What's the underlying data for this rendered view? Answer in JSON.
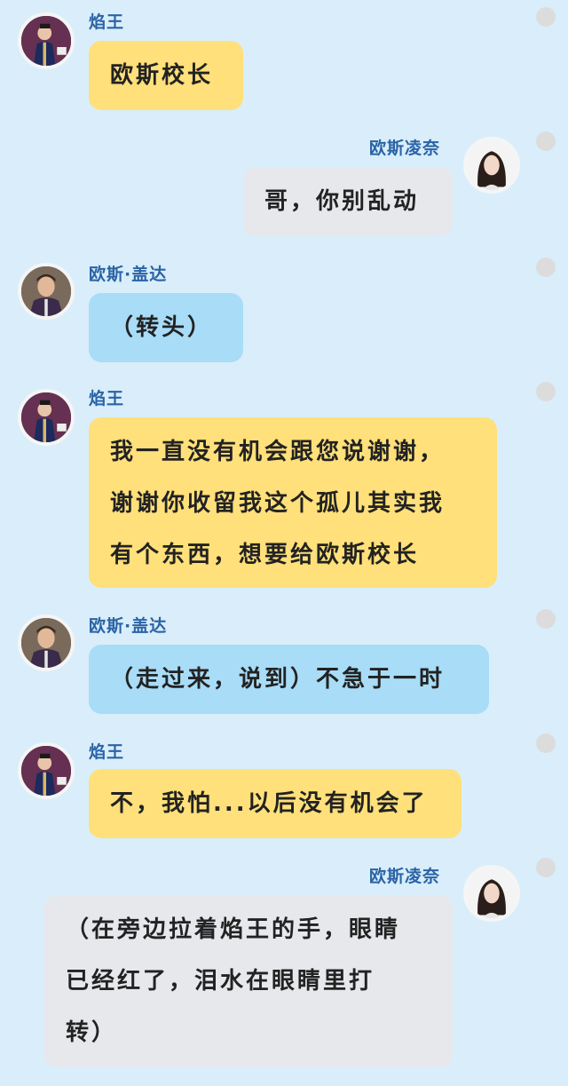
{
  "chat": {
    "messages": [
      {
        "speaker": "焰王",
        "lines": [
          "欧斯校长"
        ]
      },
      {
        "speaker": "欧斯凌奈",
        "lines": [
          "哥，你别乱动"
        ]
      },
      {
        "speaker": "欧斯·盖达",
        "lines": [
          "（转头）"
        ]
      },
      {
        "speaker": "焰王",
        "lines": [
          "我一直没有机会跟您说谢谢，",
          "谢谢你收留我这个孤儿其实我",
          "有个东西，想要给欧斯校长"
        ]
      },
      {
        "speaker": "欧斯·盖达",
        "lines": [
          "（走过来，说到）不急于一时"
        ]
      },
      {
        "speaker": "焰王",
        "lines": [
          "不，我怕...以后没有机会了"
        ]
      },
      {
        "speaker": "欧斯凌奈",
        "lines": [
          "（在旁边拉着焰王的手，眼睛",
          "已经红了，泪水在眼睛里打",
          "转）"
        ]
      }
    ]
  },
  "colors": {
    "background": "#d9eefa",
    "yanwang_bubble": "#ffe07a",
    "gaida_bubble": "#a8dcf7",
    "lingnai_bubble": "#e6e8ec",
    "speaker_name": "#2a63a6"
  }
}
